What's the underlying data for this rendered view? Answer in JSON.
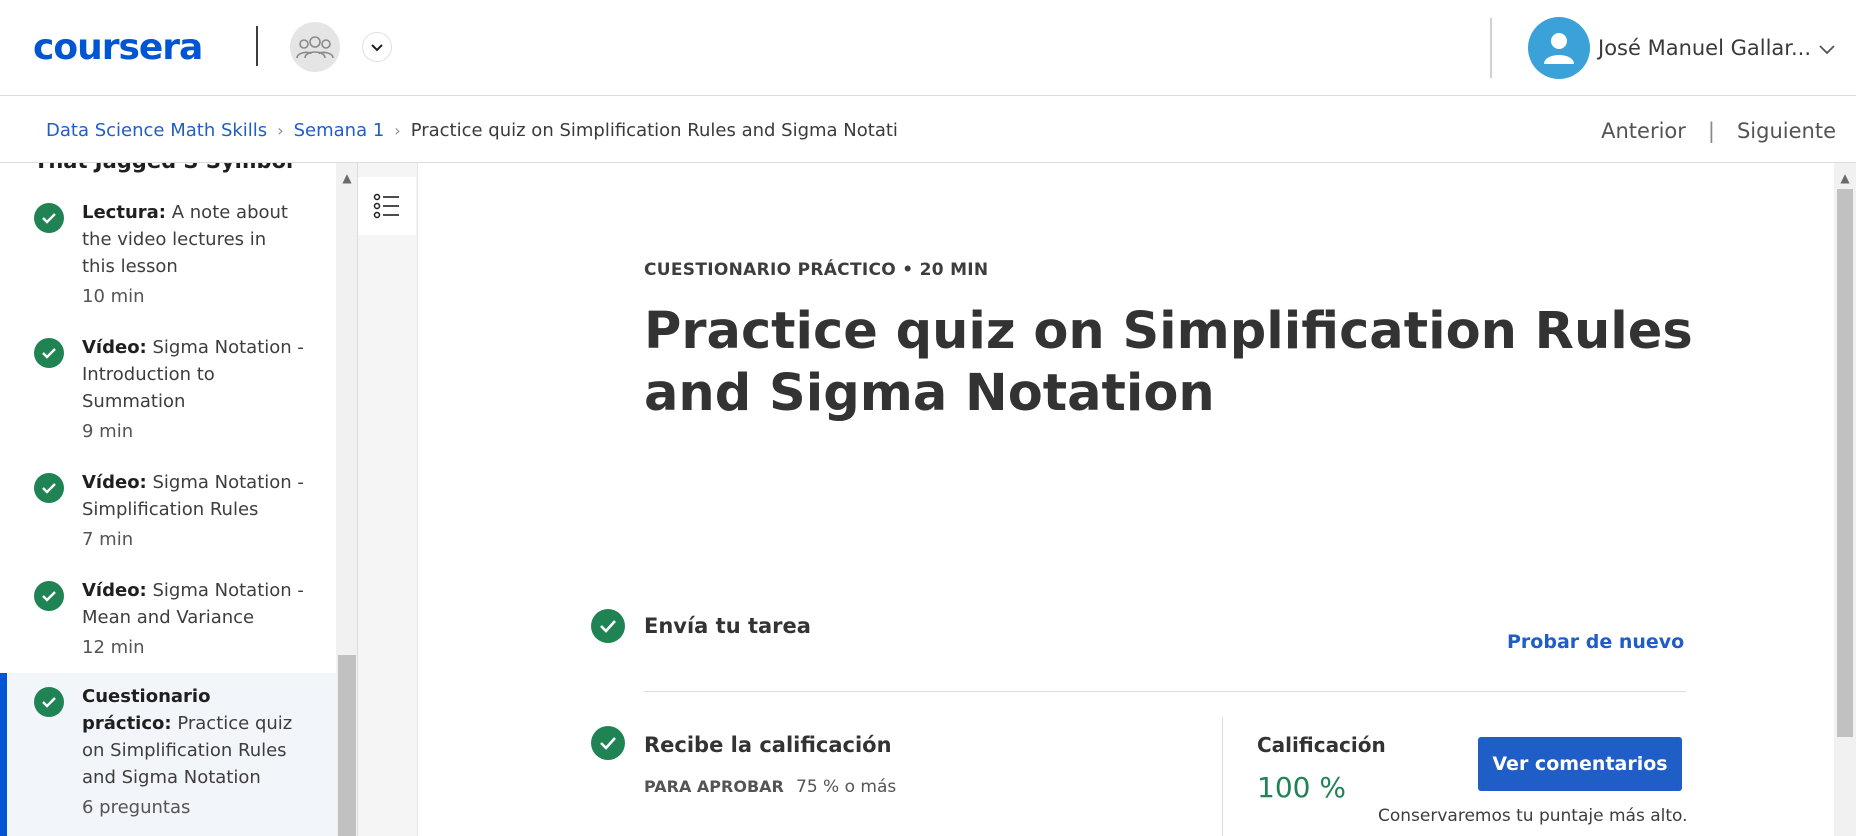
{
  "header": {
    "logo_text": "coursera",
    "brand_color": "#0056d2",
    "group_icon": "group-icon",
    "user": {
      "name": "José Manuel Gallar...",
      "avatar_icon": "user-icon",
      "avatar_color": "#3aa1d9"
    }
  },
  "breadcrumb": {
    "items": [
      "Data Science Math Skills",
      "Semana 1"
    ],
    "current": "Practice quiz on Simplification Rules and Sigma Notati",
    "prev_label": "Anterior",
    "separator": "|",
    "next_label": "Siguiente"
  },
  "sidebar": {
    "section_title": "That Jagged S Symbol",
    "items": [
      {
        "type": "Lectura:",
        "title": "A note about the video lectures in this lesson",
        "meta": "10 min",
        "completed": true,
        "active": false
      },
      {
        "type": "Vídeo:",
        "title": "Sigma Notation - Introduction to Summation",
        "meta": "9 min",
        "completed": true,
        "active": false
      },
      {
        "type": "Vídeo:",
        "title": "Sigma Notation - Simplification Rules",
        "meta": "7 min",
        "completed": true,
        "active": false
      },
      {
        "type": "Vídeo:",
        "title": "Sigma Notation - Mean and Variance",
        "meta": "12 min",
        "completed": true,
        "active": false
      },
      {
        "type": "Cuestionario práctico:",
        "title": "Practice quiz on Simplification Rules and Sigma Notation",
        "meta": "6 preguntas",
        "completed": true,
        "active": true
      }
    ],
    "status_color": "#1f8354"
  },
  "main": {
    "eyebrow": "CUESTIONARIO PRÁCTICO • 20 MIN",
    "title": "Practice quiz on Simplification Rules and Sigma Notation",
    "submit_step": {
      "title": "Envía tu tarea",
      "action": "Probar de nuevo"
    },
    "grade_step": {
      "title": "Recibe la calificación",
      "pass_label": "PARA APROBAR",
      "pass_value": "75 % o más",
      "grade_label": "Calificación",
      "grade_value": "100 %",
      "feedback_button": "Ver comentarios",
      "keep_note": "Conservaremos tu puntaje más alto."
    }
  }
}
